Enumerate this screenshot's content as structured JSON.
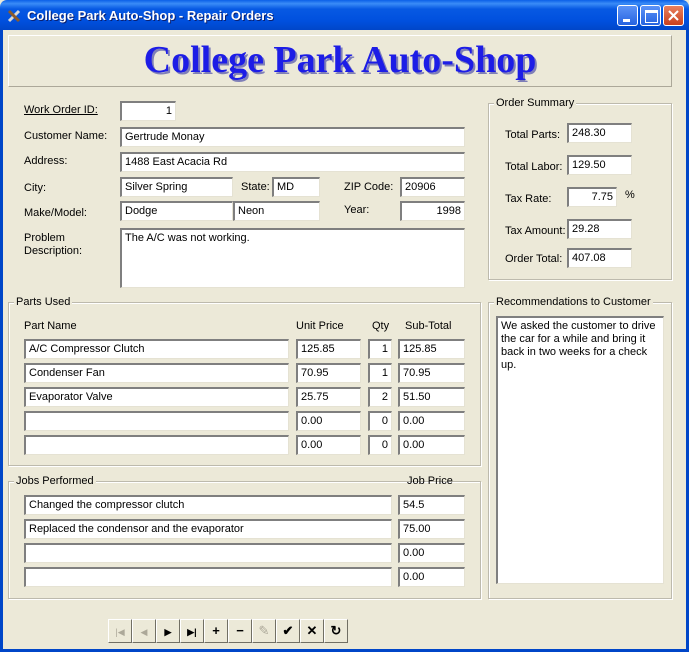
{
  "window": {
    "title": "College Park Auto-Shop - Repair Orders"
  },
  "banner": {
    "text": "College Park Auto-Shop"
  },
  "labels": {
    "work_order_id": "Work Order ID:",
    "customer_name": "Customer Name:",
    "address": "Address:",
    "city": "City:",
    "state": "State:",
    "zip": "ZIP Code:",
    "make_model": "Make/Model:",
    "year": "Year:",
    "problem_1": "Problem",
    "problem_2": "Description:"
  },
  "order": {
    "work_order_id": "1",
    "customer_name": "Gertrude Monay",
    "address": "1488 East Acacia Rd",
    "city": "Silver Spring",
    "state": "MD",
    "zip": "20906",
    "make": "Dodge",
    "model": "Neon",
    "year": "1998",
    "problem": "The A/C was not working."
  },
  "summary": {
    "title": "Order Summary",
    "total_parts_label": "Total Parts:",
    "total_parts": "248.30",
    "total_labor_label": "Total Labor:",
    "total_labor": "129.50",
    "tax_rate_label": "Tax Rate:",
    "tax_rate": "7.75",
    "percent": "%",
    "tax_amount_label": "Tax Amount:",
    "tax_amount": "29.28",
    "order_total_label": "Order Total:",
    "order_total": "407.08"
  },
  "parts": {
    "title": "Parts Used",
    "columns": {
      "name": "Part Name",
      "price": "Unit Price",
      "qty": "Qty",
      "subtotal": "Sub-Total"
    },
    "rows": [
      {
        "name": "A/C Compressor Clutch",
        "price": "125.85",
        "qty": "1",
        "subtotal": "125.85"
      },
      {
        "name": "Condenser Fan",
        "price": "70.95",
        "qty": "1",
        "subtotal": "70.95"
      },
      {
        "name": "Evaporator Valve",
        "price": "25.75",
        "qty": "2",
        "subtotal": "51.50"
      },
      {
        "name": "",
        "price": "0.00",
        "qty": "0",
        "subtotal": "0.00"
      },
      {
        "name": "",
        "price": "0.00",
        "qty": "0",
        "subtotal": "0.00"
      }
    ]
  },
  "jobs": {
    "title": "Jobs Performed",
    "price_header": "Job Price",
    "rows": [
      {
        "job": "Changed the compressor clutch",
        "price": "54.5"
      },
      {
        "job": "Replaced the condensor and the evaporator",
        "price": "75.00"
      },
      {
        "job": "",
        "price": "0.00"
      },
      {
        "job": "",
        "price": "0.00"
      }
    ]
  },
  "recommendations": {
    "title": "Recommendations to Customer",
    "text": "We asked the customer to drive the car for a while and bring it back in two weeks for a check up."
  },
  "toolbar": {
    "first": "|◀",
    "prev": "◀",
    "next": "▶",
    "last": "▶|",
    "add": "+",
    "delete": "−",
    "edit": "✎",
    "post": "✔",
    "cancel": "✕",
    "refresh": "↻"
  }
}
